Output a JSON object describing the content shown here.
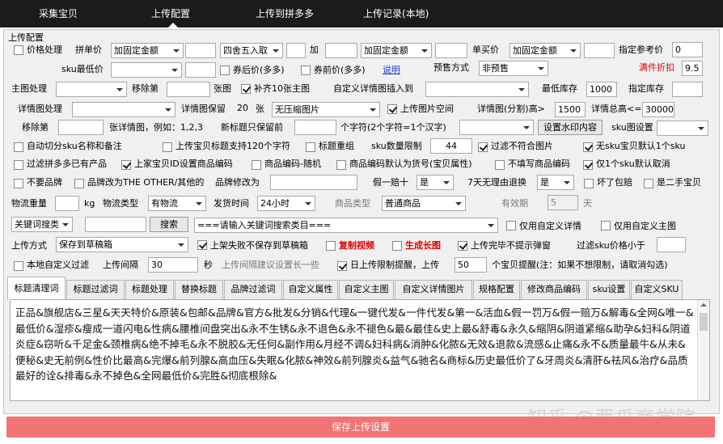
{
  "nav": {
    "tabs": [
      "采集宝贝",
      "上传配置",
      "上传到拼多多",
      "上传记录(本地)"
    ],
    "active_index": 1
  },
  "section_title": "上传配置",
  "row1": {
    "price_cb": "价格处理",
    "pinjia": "拼单价",
    "pinjia_mode": "加固定金额",
    "round_mode": "四舍五入取",
    "add_label": "加",
    "buy_mode": "加固定金额",
    "danmai": "单买价",
    "danmai_mode": "加固定金额",
    "ref_label": "指定参考价",
    "ref_value": "0"
  },
  "row2": {
    "sku_low": "sku最低价",
    "after_coupon": "券后价(多多)",
    "before_coupon": "券前价(多多)",
    "explain": "说明",
    "presale": "预售方式",
    "presale_value": "非预售",
    "full_discount": "满件折扣",
    "full_discount_value": "9.5"
  },
  "row3": {
    "main_img": "主图处理",
    "remove_nth": "移除第",
    "nth_suffix": "张图",
    "supplement": "补齐10张主图",
    "custom_detail": "自定义详情图插入到",
    "min_stock": "最低库存",
    "min_stock_value": "1000",
    "assign_stock": "指定库存"
  },
  "row4": {
    "detail_img": "详情图处理",
    "detail_preserve": "详情图保留",
    "detail_preserve_value": "20",
    "zhang": "张",
    "compress": "无压缩图片",
    "upload_space": "上传图片空间",
    "split_height": "详情图(分割)高>",
    "split_height_value": "1500",
    "total_height": "详情总高<=",
    "total_height_value": "30000"
  },
  "row5": {
    "remove_nth": "移除第",
    "example": "张详情图，例如：1,2,3",
    "new_title": "新标题只保留前",
    "chars": "个字符(2个字符=1个汉字)",
    "watermark_btn": "设置水印内容",
    "sku_img": "sku图设置"
  },
  "row6": {
    "auto_split": "自动切分sku名称和备注",
    "title_120": "上传宝贝标题支持120个字符",
    "title_reorg": "标题重组",
    "sku_limit": "sku数量限制",
    "sku_limit_value": "44",
    "filter_img": "过滤不符合图片",
    "no_sku_img": "无sku宝贝默认1个sku"
  },
  "row7": {
    "filter_dup": "过滤拼多多已有产品",
    "shop_id": "上家宝贝ID设置商品编码",
    "code_random": "商品编码-随机",
    "code_default": "商品编码默认为货号(宝贝属性)",
    "no_code": "不填写商品编码",
    "one_sku": "仅1个sku默认取消"
  },
  "row8": {
    "no_brand": "不要品牌",
    "brand_other": "品牌改为THE OTHER/其他的",
    "brand_change": "品牌修改为",
    "fake_pay": "假一赔十",
    "fake_value": "是",
    "seven_day": "7天无理由退换",
    "seven_value": "是",
    "broken": "坏了包赔",
    "second_hand": "是二手宝贝"
  },
  "row9": {
    "weight": "物流重量",
    "kg": "kg",
    "logi_type": "物流类型",
    "logi_value": "有物流",
    "ship_time": "发货时间",
    "ship_value": "24小时",
    "goods_type": "商品类型",
    "goods_value": "普通商品",
    "valid": "有效期",
    "valid_value": "5",
    "day": "天"
  },
  "row10": {
    "keyword_sel": "关键词搜类",
    "search_btn": "搜索",
    "category_sel": "===请输入关键词搜索类目===",
    "only_custom_detail": "仅用自定义详情",
    "only_custom_main": "仅用自定义主图"
  },
  "row11": {
    "upload_mode": "上传方式",
    "upload_value": "保存到草稿箱",
    "fail_no_save": "上架失败不保存到草稿箱",
    "copy_video": "复制视频",
    "gen_long": "生成长图",
    "no_popup": "上传完毕不提示弹窗",
    "filter_sku": "过滤sku价格小于"
  },
  "row12": {
    "local_filter": "本地自定义过滤",
    "interval": "上传间隔",
    "interval_value": "30",
    "sec": "秒",
    "interval_tip": "上传间隔建议设置长一些",
    "daily_limit": "日上传限制提醒，上传",
    "daily_value": "50",
    "daily_tip": "个宝贝提醒(注：如果不想限制，请取消勾选)"
  },
  "tabs": [
    "标题清理词",
    "标题过滤词",
    "标题处理",
    "替换标题",
    "品牌过滤词",
    "自定义属性",
    "自定义主图",
    "自定义详情图片",
    "规格配置",
    "修改商品编码",
    "sku设置",
    "自定义SKU"
  ],
  "active_tab": 0,
  "clean_words": "正品&旗舰店&三星&天天特价&原装&包邮&品牌&官方&批发&分销&代理&一键代发&一件代发&第一&活血&假一罚万&假一赔万&解毒&全网&唯一&最低价&湿疹&瘦成一道闪电&性病&腰椎间盘突出&永不生锈&永不退色&永不褪色&最&最佳&史上最&舒毒&永久&缩阴&阴道紧缩&助孕&妇科&阴道炎症&窃听&千足金&颈椎病&绝不掉毛&永不脱胶&无任何&副作用&月经不调&妇科病&消肿&化脓&无效&退款&流感&止痛&永不&质量最牛&从未&便秘&史无前例&性价比最高&完爆&前列腺&高血压&失眠&化脓&神效&前列腺炎&益气&驰名&商标&历史最低价了&牙周炎&清肝&祛风&治疗&品质最好的诠&排毒&永不掉色&全网最低价&完胜&彻底根除&",
  "save_button": "保存上传设置",
  "watermark": "知乎 @西瓜商学院"
}
